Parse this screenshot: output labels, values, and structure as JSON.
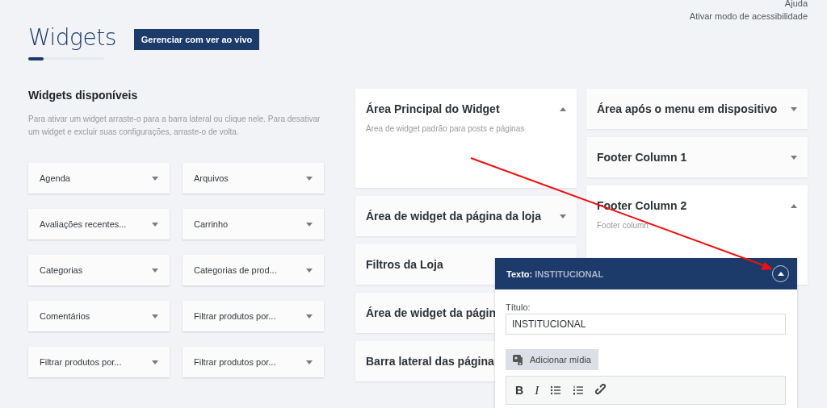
{
  "top_links": [
    "Ajuda",
    "Ativar modo de acessibilidade"
  ],
  "page_title": "Widgets",
  "live_button": "Gerenciar com ver ao vivo",
  "available": {
    "title": "Widgets disponíveis",
    "description": "Para ativar um widget arraste-o para a barra lateral ou clique nele. Para desativar um widget e excluir suas configurações, arraste-o de volta.",
    "widgets": [
      "Agenda",
      "Arquivos",
      "Avaliações recentes...",
      "Carrinho",
      "Categorias",
      "Categorias de prod...",
      "Comentários",
      "Filtrar produtos por...",
      "Filtrar produtos por...",
      "Filtrar produtos por..."
    ]
  },
  "area_columns": [
    {
      "areas": [
        {
          "title": "Área Principal do Widget",
          "expanded": true,
          "description": "Área de widget padrão para posts e páginas"
        },
        {
          "title": "Área de widget da página da loja",
          "expanded": false
        },
        {
          "title": "Filtros da Loja",
          "expanded": false
        },
        {
          "title": "Área de widget da págin",
          "expanded": false
        },
        {
          "title": "Barra lateral das página",
          "expanded": false
        }
      ]
    },
    {
      "areas": [
        {
          "title": "Área após o menu em dispositivo",
          "expanded": false
        },
        {
          "title": "Footer Column 1",
          "expanded": false
        },
        {
          "title": "Footer Column 2",
          "expanded": true,
          "description": "Footer column"
        }
      ]
    }
  ],
  "editor": {
    "type_label": "Texto:",
    "widget_title": "INSTITUCIONAL",
    "expanded": true,
    "title_label": "Título:",
    "title_value": "INSTITUCIONAL",
    "media_button": "Adicionar mídia",
    "toolbar": [
      "B",
      "I"
    ]
  }
}
